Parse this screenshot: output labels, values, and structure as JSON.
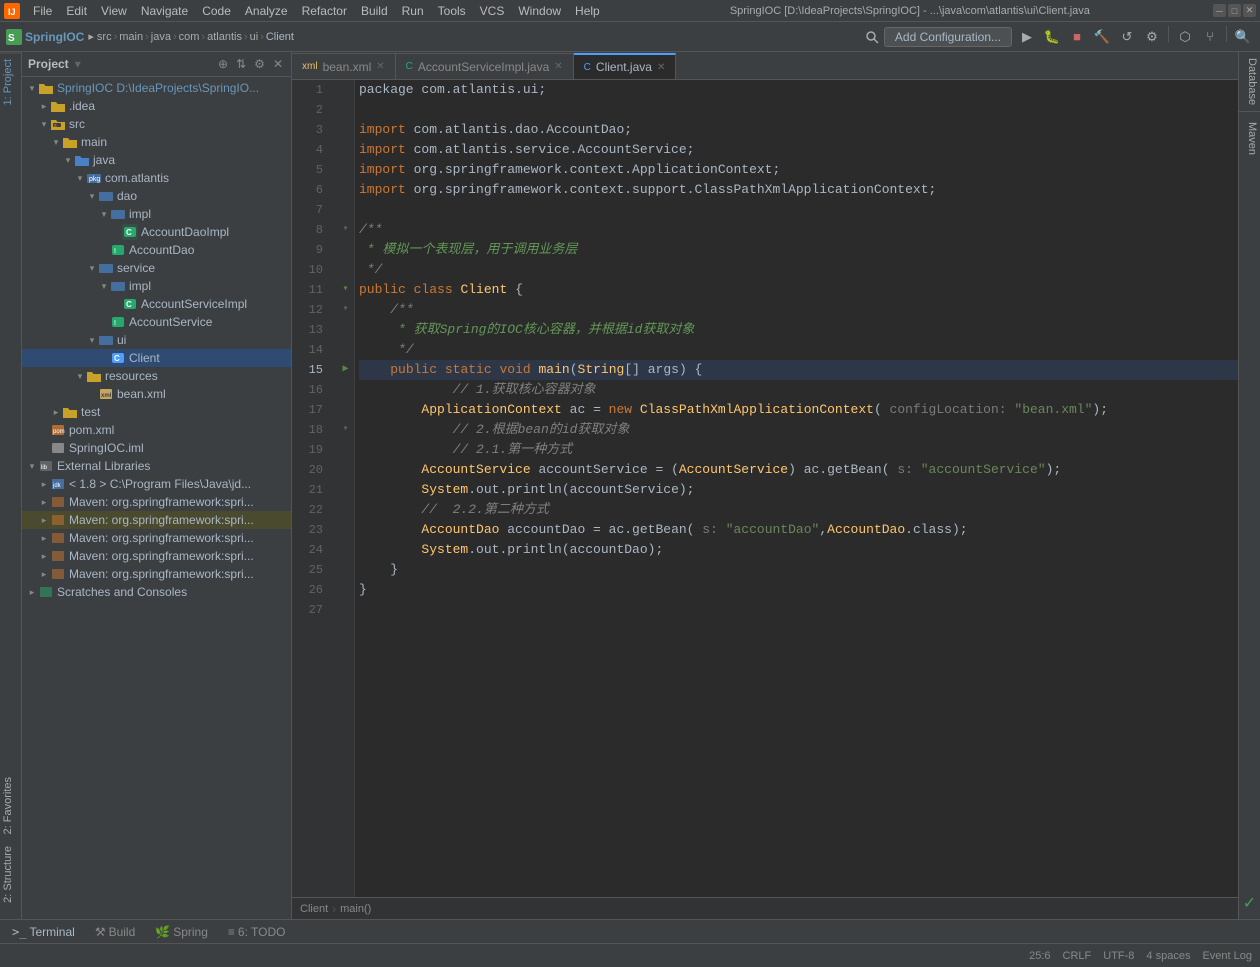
{
  "window": {
    "title": "SpringIOC [D:\\IdeaProjects\\SpringIOC] - ...\\java\\com\\atlantis\\ui\\Client.java",
    "app_name": "SpringIOC"
  },
  "menu": {
    "items": [
      "File",
      "Edit",
      "View",
      "Navigate",
      "Code",
      "Analyze",
      "Refactor",
      "Build",
      "Run",
      "Tools",
      "VCS",
      "Window",
      "Help"
    ]
  },
  "toolbar": {
    "project_name": "SpringIOC",
    "breadcrumbs": [
      "src",
      "main",
      "java",
      "com",
      "atlantis",
      "ui",
      "Client"
    ],
    "add_config_label": "Add Configuration..."
  },
  "project_panel": {
    "title": "Project",
    "root": "SpringIOC D:\\IdeaProjects\\SpringIO...",
    "items": [
      {
        "id": "idea",
        "label": ".idea",
        "type": "folder",
        "indent": 1
      },
      {
        "id": "src",
        "label": "src",
        "type": "src",
        "indent": 1,
        "expanded": true
      },
      {
        "id": "main",
        "label": "main",
        "type": "folder",
        "indent": 2,
        "expanded": true
      },
      {
        "id": "java",
        "label": "java",
        "type": "folder",
        "indent": 3,
        "expanded": true
      },
      {
        "id": "com.atlantis",
        "label": "com.atlantis",
        "type": "package",
        "indent": 4,
        "expanded": true
      },
      {
        "id": "dao",
        "label": "dao",
        "type": "folder",
        "indent": 5,
        "expanded": true
      },
      {
        "id": "impl_dao",
        "label": "impl",
        "type": "folder",
        "indent": 6,
        "expanded": true
      },
      {
        "id": "AccountDaoImpl",
        "label": "AccountDaoImpl",
        "type": "interface",
        "indent": 7
      },
      {
        "id": "AccountDao",
        "label": "AccountDao",
        "type": "interface2",
        "indent": 6
      },
      {
        "id": "service",
        "label": "service",
        "type": "folder",
        "indent": 5,
        "expanded": true
      },
      {
        "id": "impl_service",
        "label": "impl",
        "type": "folder",
        "indent": 6,
        "expanded": true
      },
      {
        "id": "AccountServiceImpl",
        "label": "AccountServiceImpl",
        "type": "interface",
        "indent": 7
      },
      {
        "id": "AccountService",
        "label": "AccountService",
        "type": "interface2",
        "indent": 6
      },
      {
        "id": "ui",
        "label": "ui",
        "type": "folder",
        "indent": 5,
        "expanded": true
      },
      {
        "id": "Client",
        "label": "Client",
        "type": "class",
        "indent": 6
      },
      {
        "id": "resources",
        "label": "resources",
        "type": "folder",
        "indent": 4,
        "expanded": true
      },
      {
        "id": "bean.xml",
        "label": "bean.xml",
        "type": "xml",
        "indent": 5
      },
      {
        "id": "test",
        "label": "test",
        "type": "folder",
        "indent": 2
      },
      {
        "id": "pom.xml",
        "label": "pom.xml",
        "type": "pom",
        "indent": 1
      },
      {
        "id": "SpringIOC.iml",
        "label": "SpringIOC.iml",
        "type": "iml",
        "indent": 1
      },
      {
        "id": "external",
        "label": "External Libraries",
        "type": "ext",
        "indent": 0,
        "expanded": true
      },
      {
        "id": "jdk",
        "label": "< 1.8 > C:\\Program Files\\Java\\jd...",
        "type": "ext_item",
        "indent": 1
      },
      {
        "id": "maven1",
        "label": "Maven: org.springframework:spri...",
        "type": "maven",
        "indent": 1
      },
      {
        "id": "maven2",
        "label": "Maven: org.springframework:spri...",
        "type": "maven",
        "indent": 1,
        "highlighted": true
      },
      {
        "id": "maven3",
        "label": "Maven: org.springframework:spri...",
        "type": "maven",
        "indent": 1
      },
      {
        "id": "maven4",
        "label": "Maven: org.springframework:spri...",
        "type": "maven",
        "indent": 1
      },
      {
        "id": "maven5",
        "label": "Maven: org.springframework:spri...",
        "type": "maven",
        "indent": 1
      },
      {
        "id": "scratches",
        "label": "Scratches and Consoles",
        "type": "folder",
        "indent": 0
      }
    ]
  },
  "tabs": [
    {
      "id": "bean",
      "label": "bean.xml",
      "type": "xml",
      "active": false
    },
    {
      "id": "accountServiceImpl",
      "label": "AccountServiceImpl.java",
      "type": "java",
      "active": false
    },
    {
      "id": "client",
      "label": "Client.java",
      "type": "java",
      "active": true
    }
  ],
  "code": {
    "filename": "Client.java",
    "lines": [
      {
        "n": 1,
        "tokens": [
          {
            "t": "plain",
            "v": "package com.atlantis.ui;"
          }
        ]
      },
      {
        "n": 2,
        "tokens": []
      },
      {
        "n": 3,
        "tokens": [
          {
            "t": "kw",
            "v": "import"
          },
          {
            "t": "plain",
            "v": " com.atlantis.dao.AccountDao;"
          }
        ]
      },
      {
        "n": 4,
        "tokens": [
          {
            "t": "kw",
            "v": "import"
          },
          {
            "t": "plain",
            "v": " com.atlantis.service.AccountService;"
          }
        ]
      },
      {
        "n": 5,
        "tokens": [
          {
            "t": "kw",
            "v": "import"
          },
          {
            "t": "plain",
            "v": " org.springframework.context.ApplicationContext;"
          }
        ]
      },
      {
        "n": 6,
        "tokens": [
          {
            "t": "kw",
            "v": "import"
          },
          {
            "t": "plain",
            "v": " org.springframework.context.support.ClassPathXmlApplicationContext;"
          }
        ]
      },
      {
        "n": 7,
        "tokens": []
      },
      {
        "n": 8,
        "tokens": [
          {
            "t": "comment",
            "v": "/**"
          }
        ]
      },
      {
        "n": 9,
        "tokens": [
          {
            "t": "chinese-comment",
            "v": " * 模拟一个表现层，用于调用业务层"
          }
        ]
      },
      {
        "n": 10,
        "tokens": [
          {
            "t": "comment",
            "v": " */"
          }
        ]
      },
      {
        "n": 11,
        "tokens": [
          {
            "t": "kw",
            "v": "public"
          },
          {
            "t": "plain",
            "v": " "
          },
          {
            "t": "kw",
            "v": "class"
          },
          {
            "t": "plain",
            "v": " "
          },
          {
            "t": "class-name",
            "v": "Client"
          },
          {
            "t": "plain",
            "v": " {"
          }
        ]
      },
      {
        "n": 12,
        "tokens": [
          {
            "t": "comment",
            "v": "    /**"
          }
        ]
      },
      {
        "n": 13,
        "tokens": [
          {
            "t": "chinese-comment",
            "v": "     * 获取Spring的IOC核心容器，并根据id获取对象"
          }
        ]
      },
      {
        "n": 14,
        "tokens": [
          {
            "t": "comment",
            "v": "     */"
          }
        ]
      },
      {
        "n": 15,
        "tokens": [
          {
            "t": "plain",
            "v": "    "
          },
          {
            "t": "kw",
            "v": "public"
          },
          {
            "t": "plain",
            "v": " "
          },
          {
            "t": "kw",
            "v": "static"
          },
          {
            "t": "plain",
            "v": " "
          },
          {
            "t": "kw",
            "v": "void"
          },
          {
            "t": "plain",
            "v": " "
          },
          {
            "t": "method",
            "v": "main"
          },
          {
            "t": "plain",
            "v": "("
          },
          {
            "t": "class-name",
            "v": "String"
          },
          {
            "t": "plain",
            "v": "[] args) {"
          }
        ]
      },
      {
        "n": 16,
        "tokens": [
          {
            "t": "comment",
            "v": "        // 1.获取核心容器对象"
          }
        ]
      },
      {
        "n": 17,
        "tokens": [
          {
            "t": "plain",
            "v": "        "
          },
          {
            "t": "class-name",
            "v": "ApplicationContext"
          },
          {
            "t": "plain",
            "v": " ac = "
          },
          {
            "t": "kw",
            "v": "new"
          },
          {
            "t": "plain",
            "v": " "
          },
          {
            "t": "class-name",
            "v": "ClassPathXmlApplicationContext"
          },
          {
            "t": "plain",
            "v": "( "
          },
          {
            "t": "param-label",
            "v": "configLocation:"
          },
          {
            "t": "plain",
            "v": " "
          },
          {
            "t": "string",
            "v": "\"bean.xml\""
          },
          {
            "t": "plain",
            "v": ");"
          }
        ]
      },
      {
        "n": 18,
        "tokens": [
          {
            "t": "comment",
            "v": "        // 2.根据bean的id获取对象"
          }
        ]
      },
      {
        "n": 19,
        "tokens": [
          {
            "t": "comment",
            "v": "        //  2.1.第一种方式"
          }
        ]
      },
      {
        "n": 20,
        "tokens": [
          {
            "t": "plain",
            "v": "        "
          },
          {
            "t": "class-name",
            "v": "AccountService"
          },
          {
            "t": "plain",
            "v": " accountService = ("
          },
          {
            "t": "class-name",
            "v": "AccountService"
          },
          {
            "t": "plain",
            "v": ") ac.getBean( "
          },
          {
            "t": "param-label",
            "v": "s:"
          },
          {
            "t": "plain",
            "v": " "
          },
          {
            "t": "string",
            "v": "\"accountService\""
          },
          {
            "t": "plain",
            "v": ");"
          }
        ]
      },
      {
        "n": 21,
        "tokens": [
          {
            "t": "plain",
            "v": "        "
          },
          {
            "t": "class-name",
            "v": "System"
          },
          {
            "t": "plain",
            "v": ".out.println(accountService);"
          }
        ]
      },
      {
        "n": 22,
        "tokens": [
          {
            "t": "comment",
            "v": "        //  2.2.第二种方式"
          }
        ]
      },
      {
        "n": 23,
        "tokens": [
          {
            "t": "plain",
            "v": "        "
          },
          {
            "t": "class-name",
            "v": "AccountDao"
          },
          {
            "t": "plain",
            "v": " accountDao = ac.getBean( "
          },
          {
            "t": "param-label",
            "v": "s:"
          },
          {
            "t": "plain",
            "v": " "
          },
          {
            "t": "string",
            "v": "\"accountDao\""
          },
          {
            "t": "plain",
            "v": ","
          },
          {
            "t": "class-name",
            "v": "AccountDao"
          },
          {
            "t": "plain",
            "v": ".class);"
          }
        ]
      },
      {
        "n": 24,
        "tokens": [
          {
            "t": "plain",
            "v": "        "
          },
          {
            "t": "class-name",
            "v": "System"
          },
          {
            "t": "plain",
            "v": ".out.println(accountDao);"
          }
        ]
      },
      {
        "n": 25,
        "tokens": [
          {
            "t": "plain",
            "v": "    }"
          }
        ]
      },
      {
        "n": 26,
        "tokens": [
          {
            "t": "plain",
            "v": "}"
          }
        ]
      },
      {
        "n": 27,
        "tokens": []
      }
    ]
  },
  "breadcrumb_bottom": {
    "items": [
      "Client",
      "main()"
    ]
  },
  "bottom_tabs": [
    {
      "id": "terminal",
      "label": "Terminal",
      "icon": ">_"
    },
    {
      "id": "build",
      "label": "Build",
      "icon": "⚒"
    },
    {
      "id": "spring",
      "label": "Spring",
      "icon": "🌿"
    },
    {
      "id": "todo",
      "label": "6: TODO",
      "icon": "✓"
    }
  ],
  "status_bar": {
    "left": [],
    "right": [
      {
        "id": "cursor",
        "label": "25:6"
      },
      {
        "id": "line_ending",
        "label": "CRLF"
      },
      {
        "id": "encoding",
        "label": "UTF-8"
      },
      {
        "id": "indent",
        "label": "4 spaces"
      },
      {
        "id": "event_log",
        "label": "Event Log"
      }
    ]
  },
  "side_panels": {
    "left_top": "1: Project",
    "left_bottom": "2: Favorites",
    "right_db": "Database",
    "right_maven": "Maven",
    "structure": "2: Structure"
  }
}
